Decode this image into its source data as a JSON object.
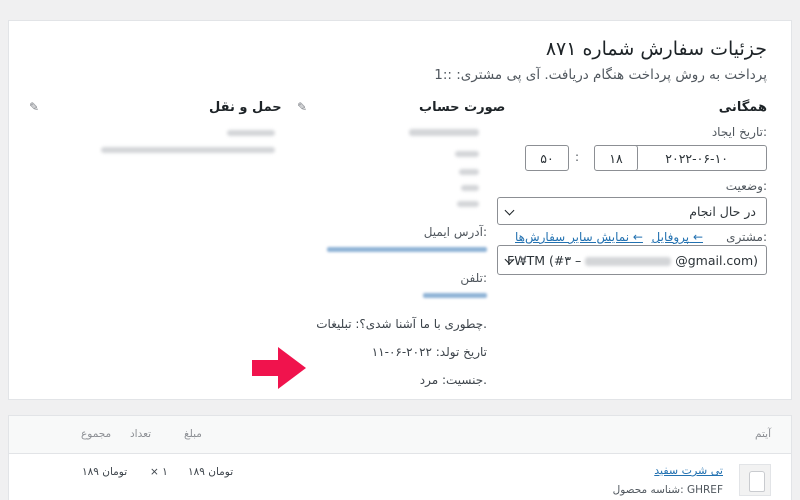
{
  "order": {
    "title": "جزئیات سفارش شماره ۸۷۱",
    "subtitle": "پرداخت به روش پرداخت هنگام دریافت. آی پی مشتری: ::1"
  },
  "general": {
    "heading": "همگانی",
    "date_created_label": "تاریخ ایجاد:",
    "date_value": "۲۰۲۲-۰۶-۱۰",
    "at_sign": "@",
    "hour": "۱۸",
    "colon": ":",
    "minute": "۵۰",
    "status_label": "وضعیت:",
    "status_value": "در حال انجام",
    "customer_label": "مشتری:",
    "profile_link": "پروفایل ←",
    "other_orders_link": "نمایش سایر سفارش‌ها ←",
    "customer_value_prefix": "FWTM (#۳ –",
    "customer_value_suffix": "@gmail.com)",
    "clear_symbol": "×"
  },
  "billing": {
    "heading": "صورت حساب",
    "email_label": "آدرس ایمیل:",
    "phone_label": "تلفن:",
    "how_found": "چطوری با ما آشنا شدی؟: تبلیغات.",
    "birth_date": "تاریخ تولد: ۲۰۲۲-۰۶-۱۱",
    "gender": "جنسیت: مرد."
  },
  "shipping": {
    "heading": "حمل و نقل"
  },
  "items": {
    "columns": {
      "item": "آیتم",
      "cost": "مبلغ",
      "qty": "تعداد",
      "total": "مجموع"
    },
    "rows": [
      {
        "name": "تی شرت سفید",
        "sku": "شناسه محصول: GHREF",
        "cost": "۱۸۹ تومان",
        "qty": "× ۱",
        "total": "۱۸۹ تومان"
      }
    ]
  },
  "colors": {
    "accent": "#2271b1",
    "arrow": "#f0134d",
    "background": "#f0f0f1"
  },
  "icons": {
    "edit": "pencil-icon",
    "arrow": "annotation-arrow",
    "dropdown": "chevron-down-icon"
  }
}
